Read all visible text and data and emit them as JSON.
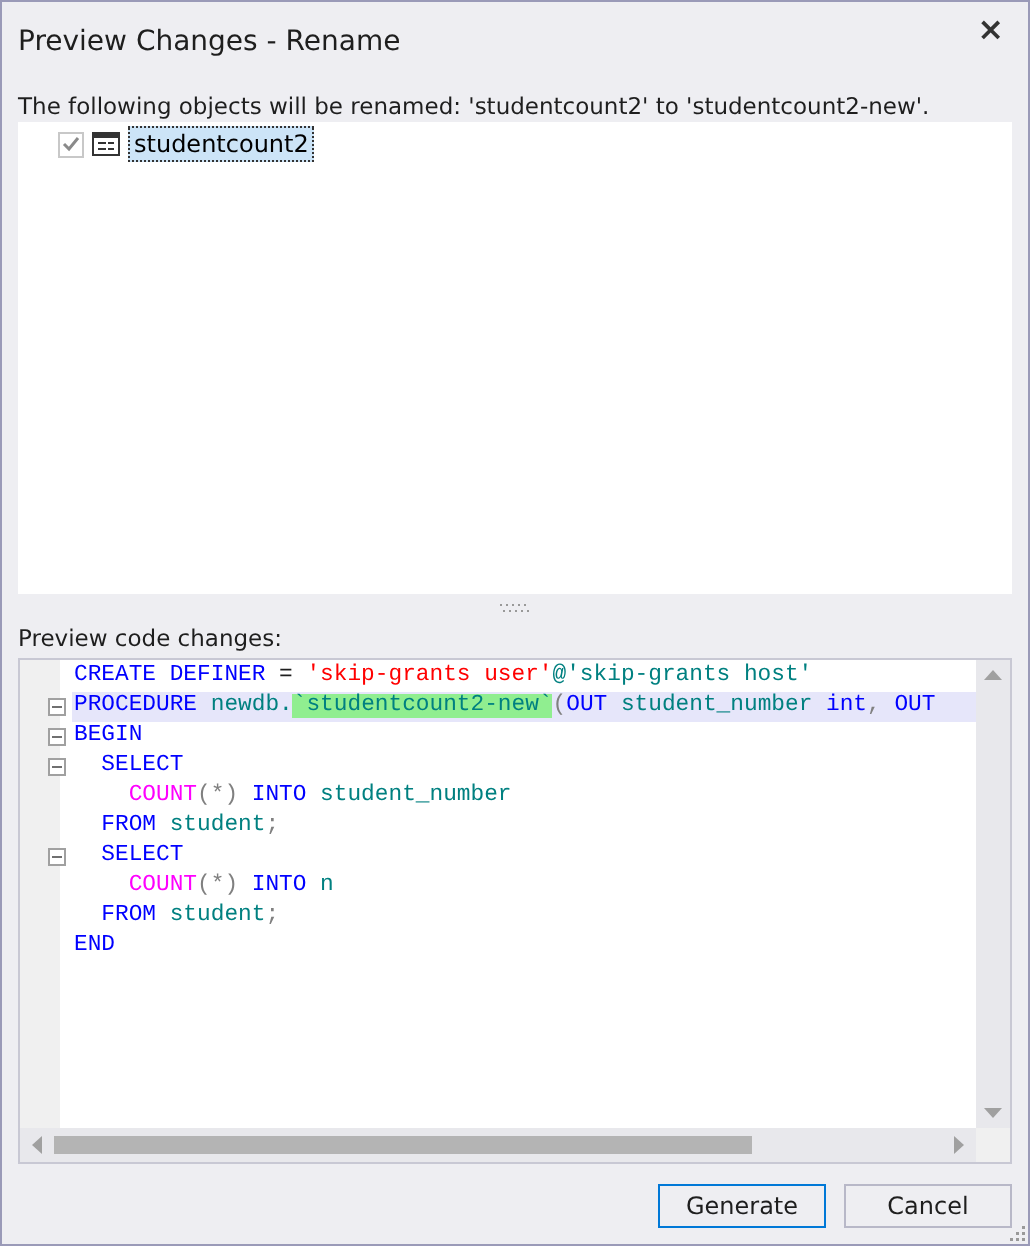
{
  "window": {
    "title": "Preview Changes - Rename",
    "close": "×"
  },
  "message": "The following objects will be renamed: 'studentcount2' to 'studentcount2-new'.",
  "objects": [
    {
      "label": "studentcount2",
      "checked": true,
      "disabled": true,
      "selected": true
    }
  ],
  "code_label": "Preview code changes:",
  "code_lines": [
    {
      "fold": false,
      "current": false,
      "tokens": [
        {
          "kind": "keyword",
          "text": "CREATE DEFINER"
        },
        {
          "kind": "plain",
          "text": " = "
        },
        {
          "kind": "string",
          "text": "'skip-grants user'"
        },
        {
          "kind": "ident",
          "text": "@'skip-grants host'"
        }
      ]
    },
    {
      "fold": true,
      "current": true,
      "tokens": [
        {
          "kind": "keyword",
          "text": "PROCEDURE"
        },
        {
          "kind": "ident",
          "text": " newdb."
        },
        {
          "kind": "match",
          "text": "`studentcount2-new`"
        },
        {
          "kind": "punct",
          "text": "("
        },
        {
          "kind": "keyword",
          "text": "OUT"
        },
        {
          "kind": "ident",
          "text": " student_number "
        },
        {
          "kind": "keyword",
          "text": "int"
        },
        {
          "kind": "punct",
          "text": ", "
        },
        {
          "kind": "keyword",
          "text": "OUT"
        }
      ]
    },
    {
      "fold": true,
      "current": false,
      "tokens": [
        {
          "kind": "keyword",
          "text": "BEGIN"
        }
      ]
    },
    {
      "fold": true,
      "current": false,
      "tokens": [
        {
          "kind": "keyword",
          "text": "  SELECT"
        }
      ]
    },
    {
      "fold": false,
      "current": false,
      "tokens": [
        {
          "kind": "function",
          "text": "    COUNT"
        },
        {
          "kind": "punct",
          "text": "(*) "
        },
        {
          "kind": "keyword",
          "text": "INTO"
        },
        {
          "kind": "ident",
          "text": " student_number"
        }
      ]
    },
    {
      "fold": false,
      "current": false,
      "tokens": [
        {
          "kind": "keyword",
          "text": "  FROM"
        },
        {
          "kind": "ident",
          "text": " student"
        },
        {
          "kind": "punct",
          "text": ";"
        }
      ]
    },
    {
      "fold": true,
      "current": false,
      "tokens": [
        {
          "kind": "keyword",
          "text": "  SELECT"
        }
      ]
    },
    {
      "fold": false,
      "current": false,
      "tokens": [
        {
          "kind": "function",
          "text": "    COUNT"
        },
        {
          "kind": "punct",
          "text": "(*) "
        },
        {
          "kind": "keyword",
          "text": "INTO"
        },
        {
          "kind": "ident",
          "text": " n"
        }
      ]
    },
    {
      "fold": false,
      "current": false,
      "tokens": [
        {
          "kind": "keyword",
          "text": "  FROM"
        },
        {
          "kind": "ident",
          "text": " student"
        },
        {
          "kind": "punct",
          "text": ";"
        }
      ]
    },
    {
      "fold": false,
      "current": false,
      "tokens": [
        {
          "kind": "keyword",
          "text": "END"
        }
      ]
    }
  ],
  "buttons": [
    {
      "label": "Generate",
      "default": true
    },
    {
      "label": "Cancel",
      "default": false
    }
  ]
}
